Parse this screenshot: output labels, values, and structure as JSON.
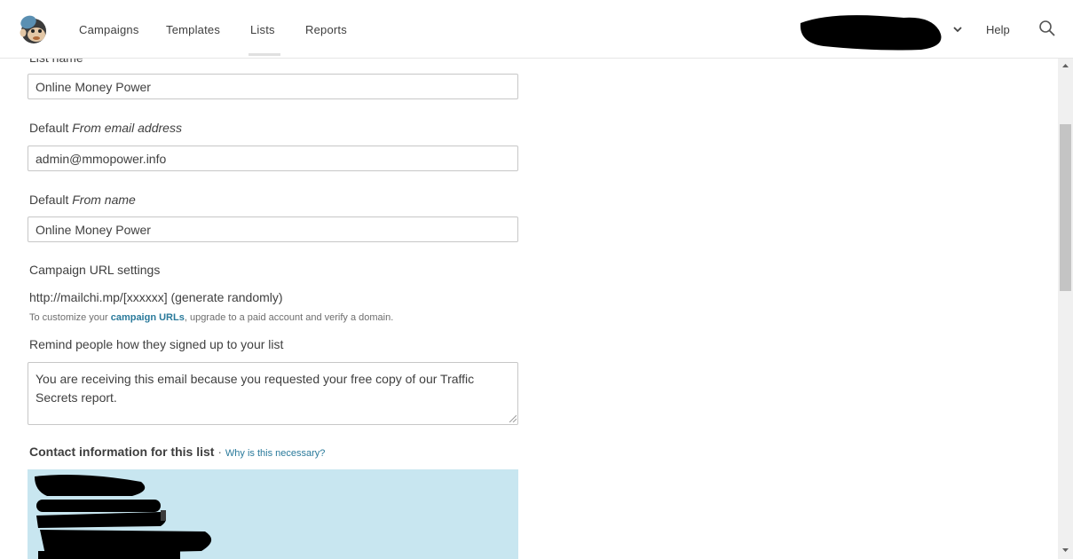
{
  "nav": {
    "items": [
      "Campaigns",
      "Templates",
      "Lists",
      "Reports"
    ],
    "active": "Lists",
    "help": "Help",
    "icons": {
      "logo": "mailchimp-logo-icon",
      "account_menu": "chevron-down-icon",
      "search": "search-icon"
    }
  },
  "form": {
    "list_name": {
      "label": "List name",
      "value": "Online Money Power"
    },
    "from_email": {
      "label_prefix": "Default ",
      "label_em": "From email address",
      "value": "admin@mmopower.info"
    },
    "from_name": {
      "label_prefix": "Default ",
      "label_em": "From name",
      "value": "Online Money Power"
    },
    "campaign_url": {
      "label": "Campaign URL settings",
      "value": "http://mailchi.mp/[xxxxxx] (generate randomly)",
      "note_prefix": "To customize your ",
      "note_link": "campaign URLs",
      "note_suffix": ", upgrade to a paid account and verify a domain."
    },
    "reminder": {
      "label": "Remind people how they signed up to your list",
      "value": "You are receiving this email because you requested your free copy of our Traffic Secrets report."
    },
    "contact": {
      "label": "Contact information for this list",
      "separator": " · ",
      "link": "Why is this necessary?"
    }
  },
  "colors": {
    "contact_box": "#c8e6f0",
    "link": "#2a7a9b",
    "redaction": "#000000"
  }
}
